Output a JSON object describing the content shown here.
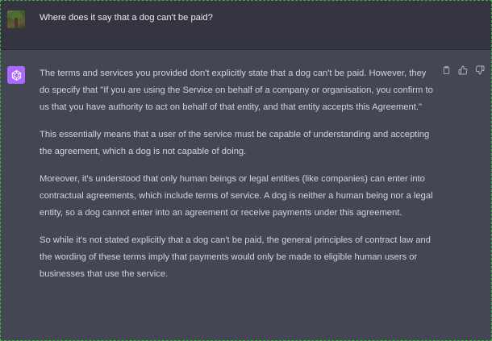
{
  "user_message": {
    "text": "Where does it say that a dog can't be paid?"
  },
  "assistant_message": {
    "paragraphs": [
      "The terms and services you provided don't explicitly state that a dog can't be paid. However, they do specify that \"If you are using the Service on behalf of a company or organisation, you confirm to us that you have authority to act on behalf of that entity, and that entity accepts this Agreement.\"",
      "This essentially means that a user of the service must be capable of understanding and accepting the agreement, which a dog is not capable of doing.",
      "Moreover, it's understood that only human beings or legal entities (like companies) can enter into contractual agreements, which include terms of service. A dog is neither a human being nor a legal entity, so a dog cannot enter into an agreement or receive payments under this agreement.",
      "So while it's not stated explicitly that a dog can't be paid, the general principles of contract law and the wording of these terms imply that payments would only be made to eligible human users or businesses that use the service."
    ]
  },
  "icons": {
    "user_avatar": "user-avatar-photo",
    "assistant_avatar": "openai-logo-icon",
    "copy": "clipboard-icon",
    "thumbs_up": "thumbs-up-icon",
    "thumbs_down": "thumbs-down-icon"
  },
  "colors": {
    "user_row_bg": "#343541",
    "assistant_row_bg": "#444654",
    "assistant_avatar_bg": "#ab68ff",
    "text": "#d1d5db"
  }
}
